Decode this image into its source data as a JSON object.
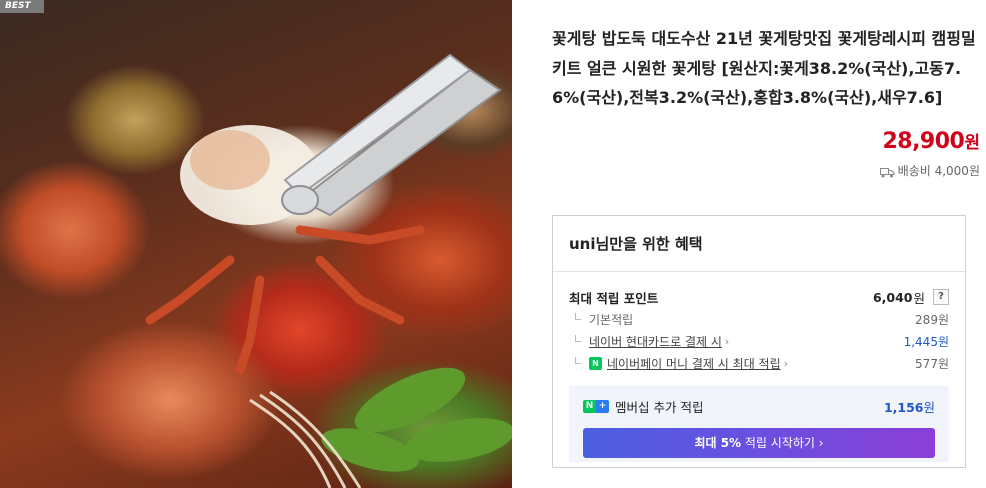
{
  "badge": "BEST",
  "product": {
    "title": "꽃게탕 밥도둑 대도수산 21년 꽃게탕맛집 꽃게탕레시피 캠핑밀키트 얼큰 시원한 꽃게탕 [원산지:꽃게38.2%(국산),고동7.6%(국산),전복3.2%(국산),홍합3.8%(국산),새우7.6]",
    "price": "28,900",
    "price_unit": "원",
    "shipping": "배송비 4,000원"
  },
  "benefit": {
    "header": "uni님만을 위한 혜택",
    "max_points_label": "최대 적립 포인트",
    "max_points_value": "6,040",
    "unit": "원",
    "help_label": "?",
    "rows": [
      {
        "label": "기본적립",
        "value": "289원"
      },
      {
        "label": "네이버 현대카드로 결제 시",
        "value": "1,445원"
      },
      {
        "label": "네이버페이 머니 결제 시 최대 적립",
        "value": "577원"
      }
    ],
    "member": {
      "label": "멤버십 추가 적립",
      "value": "1,156",
      "unit": "원",
      "cta_strong": "최대 5%",
      "cta_rest": " 적립 시작하기 ›"
    }
  },
  "colors": {
    "price": "#d0021b",
    "link_blue": "#1e59c8",
    "naver_green": "#03c75a",
    "cta_start": "#4b5fe0",
    "cta_end": "#8b3fd6"
  },
  "icons": {
    "shipping": "truck-icon",
    "help": "question-icon",
    "npay": "npay-icon",
    "membership": "naver-plus-icon"
  }
}
